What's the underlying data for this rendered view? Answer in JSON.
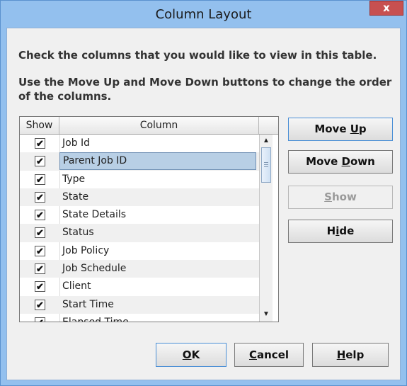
{
  "window": {
    "title": "Column Layout",
    "close_label": "x"
  },
  "instructions": {
    "line1": "Check the columns that you would like to view in this table.",
    "line2": "Use the Move Up and Move Down buttons to change the order",
    "line3": "of the columns."
  },
  "table": {
    "headers": {
      "show": "Show",
      "column": "Column"
    },
    "rows": [
      {
        "label": "Job Id",
        "checked": true
      },
      {
        "label": "Parent Job ID",
        "checked": true,
        "selected": true
      },
      {
        "label": "Type",
        "checked": true
      },
      {
        "label": "State",
        "checked": true
      },
      {
        "label": "State Details",
        "checked": true
      },
      {
        "label": "Status",
        "checked": true
      },
      {
        "label": "Job Policy",
        "checked": true
      },
      {
        "label": "Job Schedule",
        "checked": true
      },
      {
        "label": "Client",
        "checked": true
      },
      {
        "label": "Start Time",
        "checked": true
      },
      {
        "label": "Elapsed Time",
        "checked": true
      }
    ]
  },
  "side_buttons": {
    "move_up": "Move Up",
    "move_down": "Move Down",
    "show": "Show",
    "hide": "Hide"
  },
  "footer_buttons": {
    "ok": "OK",
    "cancel": "Cancel",
    "help": "Help"
  }
}
